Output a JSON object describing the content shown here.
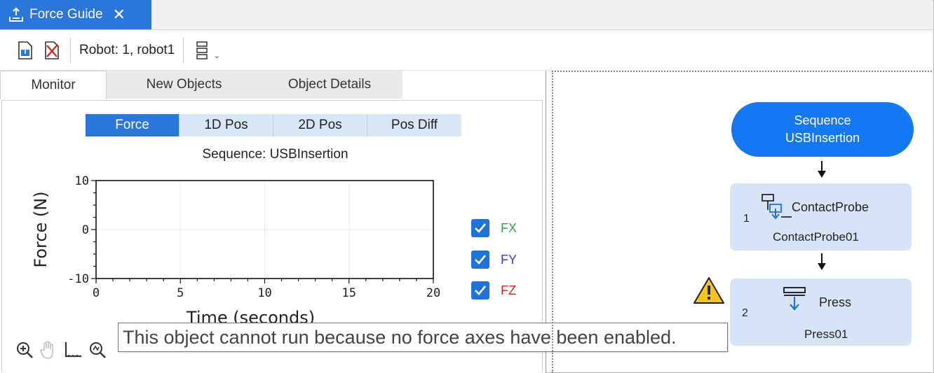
{
  "window": {
    "tab_title": "Force Guide",
    "tab_icon": "force-guide-icon",
    "close_glyph": "✕"
  },
  "toolbar": {
    "robot_label": "Robot: 1, robot1",
    "more_glyph": "⌄"
  },
  "subtabs": [
    "Monitor",
    "New Objects",
    "Object Details"
  ],
  "monitor": {
    "segments": [
      "Force",
      "1D Pos",
      "2D Pos",
      "Pos Diff"
    ],
    "active_segment": "Force",
    "legend": [
      {
        "label": "FX",
        "checked": true,
        "color": "#2ea44f"
      },
      {
        "label": "FY",
        "checked": true,
        "color": "#3a3af0"
      },
      {
        "label": "FZ",
        "checked": true,
        "color": "#e02020"
      }
    ]
  },
  "chart_data": {
    "type": "line",
    "title": "Sequence: USBInsertion",
    "xlabel": "Time (seconds)",
    "ylabel": "Force (N)",
    "xlim": [
      0,
      20
    ],
    "ylim": [
      -10,
      10
    ],
    "xticks": [
      "0",
      "5",
      "10",
      "15",
      "20"
    ],
    "yticks": [
      "10",
      "0",
      "-10"
    ],
    "grid": true,
    "series": []
  },
  "tooltip": "This object cannot run because no force axes have been enabled.",
  "flow": {
    "sequence_label": "Sequence",
    "sequence_name": "USBInsertion",
    "objects": [
      {
        "number": "1",
        "type": "ContactProbe",
        "name": "ContactProbe01",
        "warning": false
      },
      {
        "number": "2",
        "type": "Press",
        "name": "Press01",
        "warning": true
      }
    ]
  },
  "colors": {
    "accent": "#2b77d9",
    "sequence_node": "#1478f2",
    "object_node": "#d7e4f7",
    "warning": "#f5c518"
  }
}
